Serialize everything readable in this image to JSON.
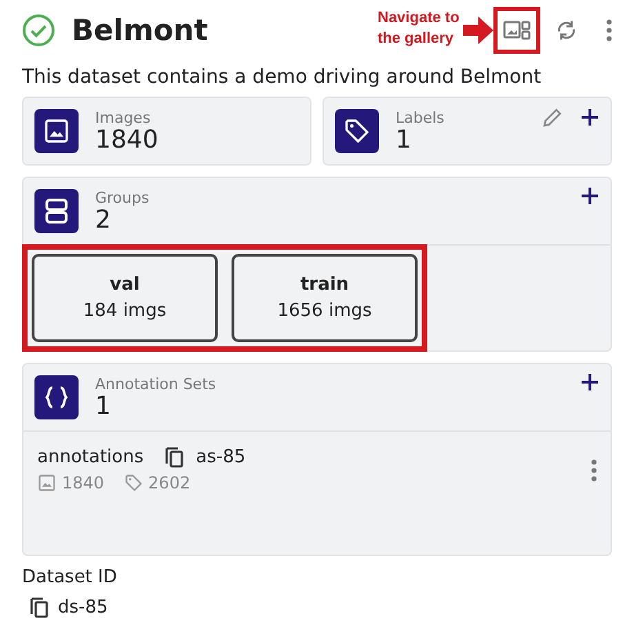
{
  "header": {
    "title": "Belmont",
    "complete": true,
    "callout": "Navigate to the gallery"
  },
  "description": "This dataset contains a demo driving around Belmont",
  "stats": [
    {
      "kind": "images",
      "label": "Images",
      "value": "1840",
      "editable": false
    },
    {
      "kind": "labels",
      "label": "Labels",
      "value": "1",
      "editable": true
    }
  ],
  "groups": {
    "label": "Groups",
    "value": "2",
    "highlighted": true,
    "items": [
      {
        "name": "val",
        "count": "184 imgs"
      },
      {
        "name": "train",
        "count": "1656 imgs"
      }
    ]
  },
  "annotation_sets": {
    "label": "Annotation Sets",
    "value": "1",
    "items": [
      {
        "name": "annotations",
        "id": "as-85",
        "images": "1840",
        "labels": "2602"
      }
    ]
  },
  "dataset_id": {
    "label": "Dataset ID",
    "value": "ds-85"
  }
}
